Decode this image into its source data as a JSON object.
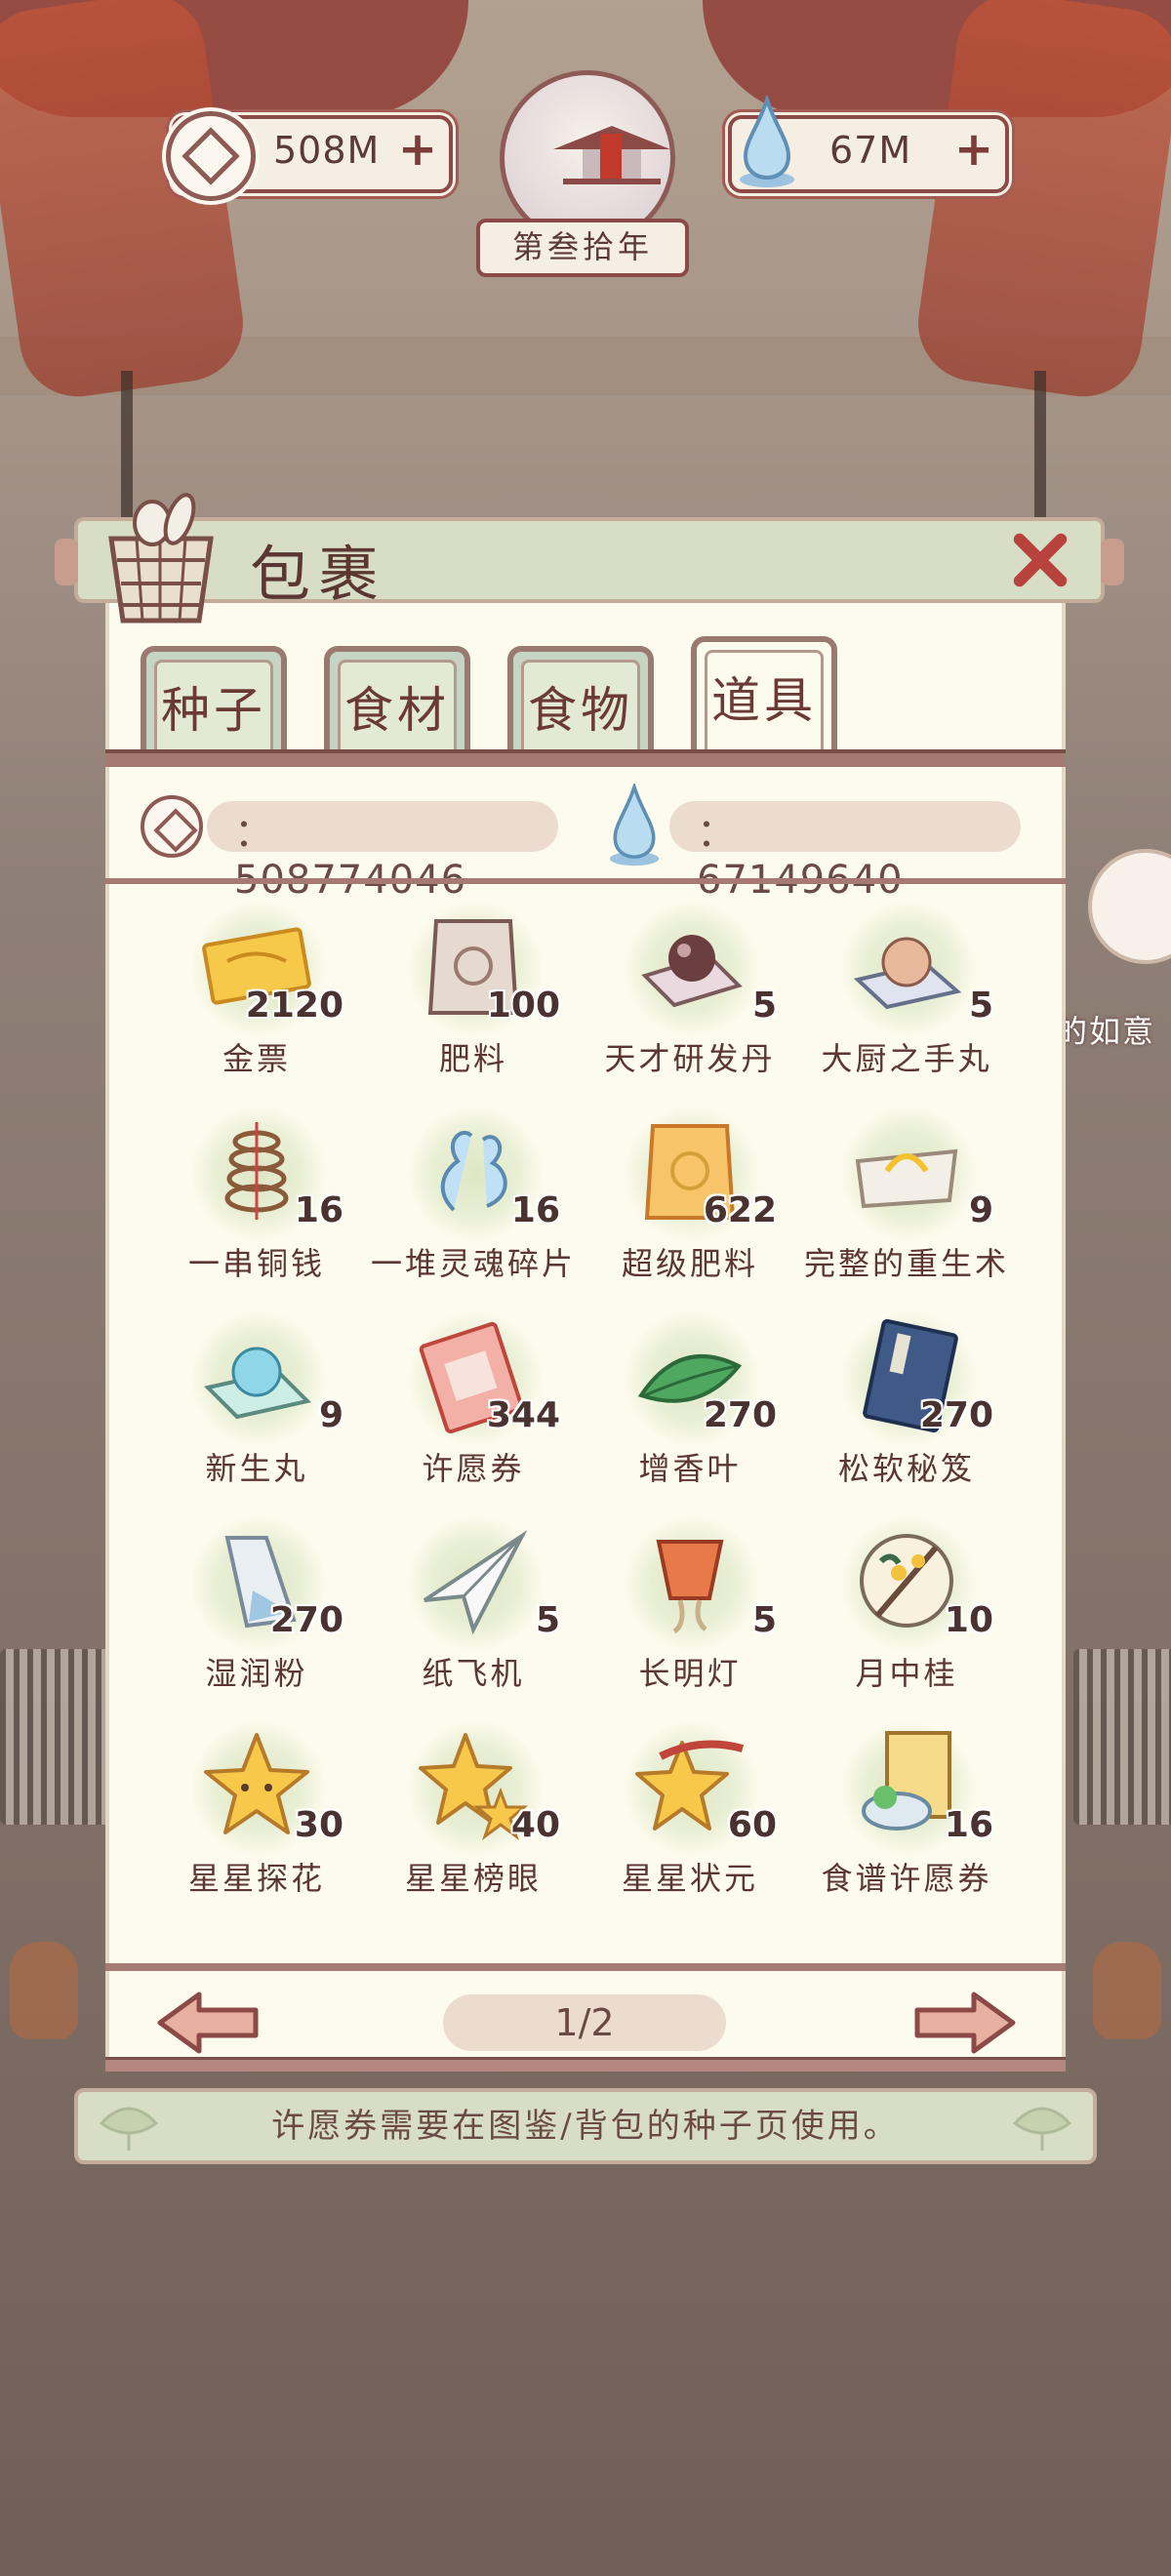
{
  "hud": {
    "coins": "508M",
    "spirit": "67M",
    "year": "第叁拾年"
  },
  "panel": {
    "title": "包裹",
    "tabs": [
      {
        "label": "种子",
        "active": false
      },
      {
        "label": "食材",
        "active": false
      },
      {
        "label": "食物",
        "active": false
      },
      {
        "label": "道具",
        "active": true
      }
    ],
    "coins_total": "：508774046",
    "spirit_total": "：67149640",
    "items": [
      {
        "name": "金票",
        "count": "2120",
        "icon": "gold-ticket-icon"
      },
      {
        "name": "肥料",
        "count": "100",
        "icon": "fertilizer-bag-icon"
      },
      {
        "name": "天才研发丹",
        "count": "5",
        "icon": "genius-pill-icon"
      },
      {
        "name": "大厨之手丸",
        "count": "5",
        "icon": "chef-pill-icon"
      },
      {
        "name": "一串铜钱",
        "count": "16",
        "icon": "copper-coins-icon"
      },
      {
        "name": "一堆灵魂碎片",
        "count": "16",
        "icon": "soul-fragments-icon"
      },
      {
        "name": "超级肥料",
        "count": "622",
        "icon": "super-fertilizer-icon"
      },
      {
        "name": "完整的重生术",
        "count": "9",
        "icon": "rebirth-scroll-icon"
      },
      {
        "name": "新生丸",
        "count": "9",
        "icon": "rebirth-pill-icon"
      },
      {
        "name": "许愿券",
        "count": "344",
        "icon": "wish-ticket-icon"
      },
      {
        "name": "增香叶",
        "count": "270",
        "icon": "aroma-leaf-icon"
      },
      {
        "name": "松软秘笈",
        "count": "270",
        "icon": "secret-book-icon"
      },
      {
        "name": "湿润粉",
        "count": "270",
        "icon": "moist-powder-icon"
      },
      {
        "name": "纸飞机",
        "count": "5",
        "icon": "paper-plane-icon"
      },
      {
        "name": "长明灯",
        "count": "5",
        "icon": "sky-lantern-icon"
      },
      {
        "name": "月中桂",
        "count": "10",
        "icon": "moon-osmanthus-icon"
      },
      {
        "name": "星星探花",
        "count": "30",
        "icon": "star-icon"
      },
      {
        "name": "星星榜眼",
        "count": "40",
        "icon": "double-star-icon"
      },
      {
        "name": "星星状元",
        "count": "60",
        "icon": "star-champion-icon"
      },
      {
        "name": "食谱许愿券",
        "count": "16",
        "icon": "recipe-wish-ticket-icon"
      }
    ],
    "page": "1/2"
  },
  "tip": "许愿券需要在图鉴/背包的种子页使用。",
  "side_label": "的如意",
  "colors": {
    "frame": "#8b4a45",
    "paper": "#fdfbee",
    "header_green": "#d7dec5",
    "text_brown": "#5b3632"
  }
}
